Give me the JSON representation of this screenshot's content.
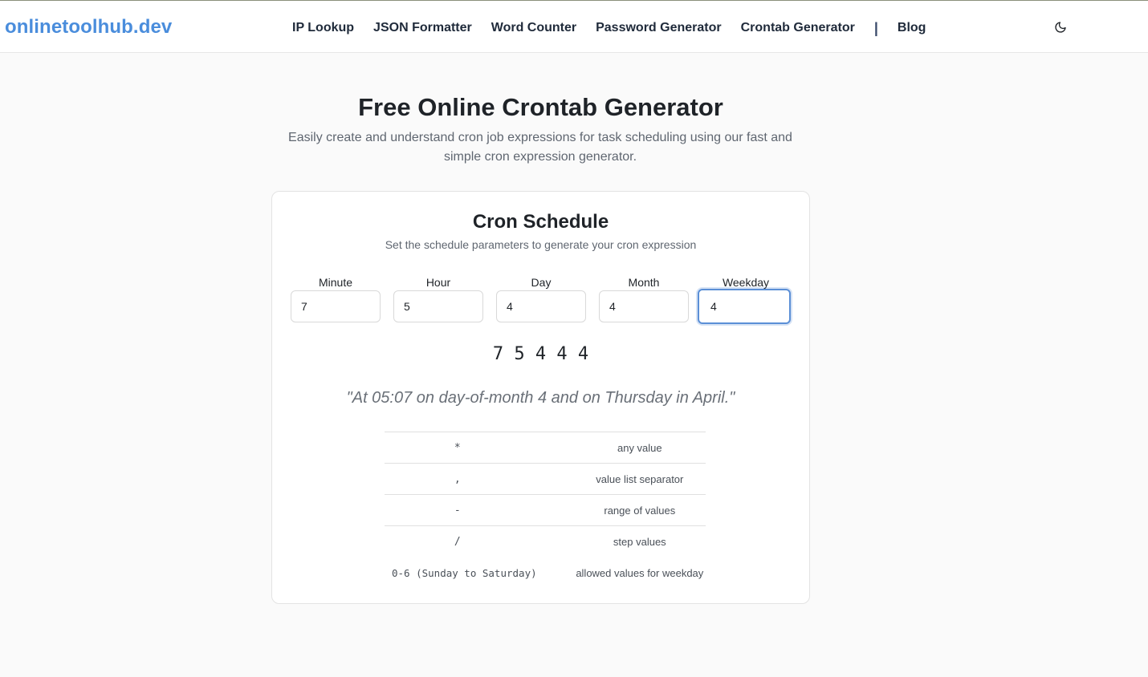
{
  "header": {
    "logo": "onlinetoolhub.dev",
    "nav": [
      "IP Lookup",
      "JSON Formatter",
      "Word Counter",
      "Password Generator",
      "Crontab Generator"
    ],
    "separator": "|",
    "blog": "Blog",
    "theme_icon": "moon-icon"
  },
  "hero": {
    "title": "Free Online Crontab Generator",
    "subtitle": "Easily create and understand cron job expressions for task scheduling using our fast and simple cron expression generator."
  },
  "schedule": {
    "title": "Cron Schedule",
    "description": "Set the schedule parameters to generate your cron expression",
    "fields": [
      {
        "label": "Minute",
        "value": "7"
      },
      {
        "label": "Hour",
        "value": "5"
      },
      {
        "label": "Day",
        "value": "4"
      },
      {
        "label": "Month",
        "value": "4"
      },
      {
        "label": "Weekday",
        "value": "4"
      }
    ],
    "expression": "7 5 4 4 4",
    "human_readable": "\"At 05:07 on day-of-month 4 and on Thursday in April.\"",
    "legend": [
      {
        "symbol": "*",
        "meaning": "any value"
      },
      {
        "symbol": ",",
        "meaning": "value list separator"
      },
      {
        "symbol": "-",
        "meaning": "range of values"
      },
      {
        "symbol": "/",
        "meaning": "step values"
      },
      {
        "symbol": "0-6 (Sunday to Saturday)",
        "meaning": "allowed values for weekday"
      }
    ]
  }
}
